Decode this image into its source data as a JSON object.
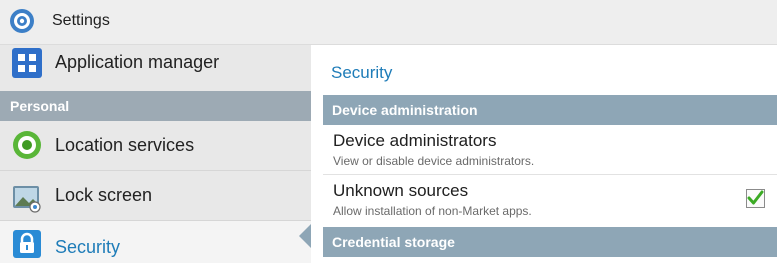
{
  "titlebar": {
    "title": "Settings",
    "icon": "settings-gear-icon"
  },
  "sidebar": {
    "items_top": [
      {
        "label": "Application manager",
        "icon": "grid-apps-icon"
      }
    ],
    "section": "Personal",
    "items": [
      {
        "label": "Location services",
        "icon": "location-target-icon"
      },
      {
        "label": "Lock screen",
        "icon": "lock-screen-image-icon"
      },
      {
        "label": "Security",
        "icon": "padlock-icon",
        "selected": true
      }
    ]
  },
  "pane": {
    "title": "Security",
    "sections": [
      {
        "header": "Device administration",
        "rows": [
          {
            "title": "Device administrators",
            "desc": "View or disable device administrators."
          },
          {
            "title": "Unknown sources",
            "desc": "Allow installation of non-Market apps.",
            "checked": true
          }
        ]
      },
      {
        "header": "Credential storage"
      }
    ]
  },
  "colors": {
    "accent": "#1e7cb8",
    "section_header_bg": "#8ea6b6",
    "check_green": "#3cab25"
  }
}
